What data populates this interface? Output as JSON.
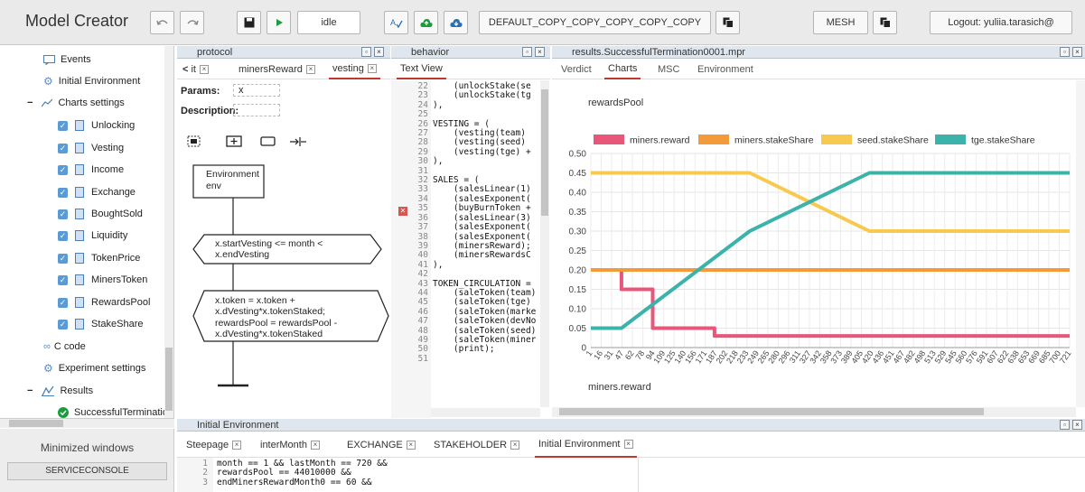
{
  "toolbar": {
    "app_title": "Model Creator",
    "status": "idle",
    "model_name": "DEFAULT_COPY_COPY_COPY_COPY_COPY",
    "mesh_label": "MESH",
    "logout_label": "Logout: yuliia.tarasich@"
  },
  "tree": {
    "items": [
      {
        "label": "Events",
        "icon": "chat-icon"
      },
      {
        "label": "Initial Environment",
        "icon": "gear-icon"
      },
      {
        "label": "Charts settings",
        "icon": "chart-line-icon"
      },
      {
        "label": "Unlocking",
        "icon": "file-icon"
      },
      {
        "label": "Vesting",
        "icon": "file-icon"
      },
      {
        "label": "Income",
        "icon": "file-icon"
      },
      {
        "label": "Exchange",
        "icon": "file-icon"
      },
      {
        "label": "BoughtSold",
        "icon": "file-icon"
      },
      {
        "label": "Liquidity",
        "icon": "file-icon"
      },
      {
        "label": "TokenPrice",
        "icon": "file-icon"
      },
      {
        "label": "MinersToken",
        "icon": "file-icon"
      },
      {
        "label": "RewardsPool",
        "icon": "file-icon"
      },
      {
        "label": "StakeShare",
        "icon": "file-icon"
      },
      {
        "label": "C code",
        "icon": "link-icon"
      },
      {
        "label": "Experiment settings",
        "icon": "gear-icon"
      },
      {
        "label": "Results",
        "icon": "results-icon"
      },
      {
        "label": "SuccessfulTerminatio",
        "icon": "check-circle-icon"
      }
    ]
  },
  "minimized": {
    "title": "Minimized windows",
    "item": "SERVICECONSOLE"
  },
  "protocol": {
    "header": "protocol",
    "tabs": [
      "it",
      "minersReward",
      "vesting"
    ],
    "params_label": "Params:",
    "params_value": "x",
    "description_label": "Description:",
    "env_box_line1": "Environment",
    "env_box_line2": "env",
    "cond1_line1": "x.startVesting <= month <",
    "cond1_line2": "x.endVesting",
    "cond2_lines": [
      "x.token = x.token +",
      "x.dVesting*x.tokenStaked;",
      "rewardsPool = rewardsPool -",
      "x.dVesting*x.tokenStaked"
    ]
  },
  "behavior": {
    "header": "behavior",
    "tab": "Text View",
    "line_numbers": "22\n23\n24\n25\n26\n27\n28\n29\n30\n31\n32\n33\n34\n35\n36\n37\n38\n39\n40\n41\n42\n43\n44\n45\n46\n47\n48\n49\n50\n51",
    "code": "    (unlockStake(se\n    (unlockStake(tg\n),\n\nVESTING = (\n    (vesting(team)\n    (vesting(seed)\n    (vesting(tge) +\n),\n\nSALES = (\n    (salesLinear(1)\n    (salesExponent(\n    (buyBurnToken +\n    (salesLinear(3)\n    (salesExponent(\n    (salesExponent(\n    (minersReward);\n    (minersRewardsC\n),\n\nTOKEN_CIRCULATION =\n    (saleToken(team)\n    (saleToken(tge)\n    (saleToken(marke\n    (saleToken(devNo\n    (saleToken(seed)\n    (saleToken(miner\n    (print);\n"
  },
  "results": {
    "header": "results.SuccessfulTermination0001.mpr",
    "tabs": [
      "Verdict",
      "Charts",
      "MSC",
      "Environment"
    ],
    "active_tab": "Charts",
    "chart_title": "rewardsPool",
    "bottom_label": "miners.reward"
  },
  "chart_data": {
    "type": "line",
    "title": "rewardsPool",
    "xlabel": "",
    "ylabel": "",
    "ylim": [
      0,
      0.5
    ],
    "yticks": [
      "0",
      "0.05",
      "0.10",
      "0.15",
      "0.20",
      "0.25",
      "0.30",
      "0.35",
      "0.40",
      "0.45",
      "0.50"
    ],
    "xticks": [
      "1",
      "16",
      "31",
      "47",
      "62",
      "78",
      "94",
      "109",
      "125",
      "140",
      "156",
      "171",
      "187",
      "202",
      "218",
      "233",
      "249",
      "265",
      "280",
      "296",
      "311",
      "327",
      "342",
      "358",
      "373",
      "389",
      "405",
      "420",
      "436",
      "451",
      "467",
      "482",
      "498",
      "513",
      "529",
      "545",
      "560",
      "576",
      "591",
      "607",
      "622",
      "638",
      "653",
      "669",
      "685",
      "700",
      "721"
    ],
    "legend_position": "top",
    "grid": true,
    "series": [
      {
        "name": "miners.reward",
        "color": "#e8577a",
        "points": [
          [
            1,
            0.2
          ],
          [
            47,
            0.2
          ],
          [
            47,
            0.15
          ],
          [
            94,
            0.15
          ],
          [
            94,
            0.05
          ],
          [
            187,
            0.05
          ],
          [
            187,
            0.03
          ],
          [
            721,
            0.03
          ]
        ]
      },
      {
        "name": "miners.stakeShare",
        "color": "#f39a3a",
        "points": [
          [
            1,
            0.2
          ],
          [
            721,
            0.2
          ]
        ]
      },
      {
        "name": "seed.stakeShare",
        "color": "#f7c94f",
        "points": [
          [
            1,
            0.45
          ],
          [
            240,
            0.45
          ],
          [
            420,
            0.3
          ],
          [
            721,
            0.3
          ]
        ]
      },
      {
        "name": "tge.stakeShare",
        "color": "#3bb3ab",
        "points": [
          [
            1,
            0.05
          ],
          [
            47,
            0.05
          ],
          [
            240,
            0.3
          ],
          [
            420,
            0.45
          ],
          [
            721,
            0.45
          ]
        ]
      }
    ]
  },
  "initial_env": {
    "header": "Initial Environment",
    "tabs": [
      "Steepage",
      "interMonth",
      "EXCHANGE",
      "STAKEHOLDER",
      "Initial Environment"
    ],
    "line_numbers": "1\n2\n3",
    "code": "month == 1 && lastMonth == 720 &&\nrewardsPool == 44010000 &&\nendMinersRewardMonth0 == 60 &&"
  }
}
